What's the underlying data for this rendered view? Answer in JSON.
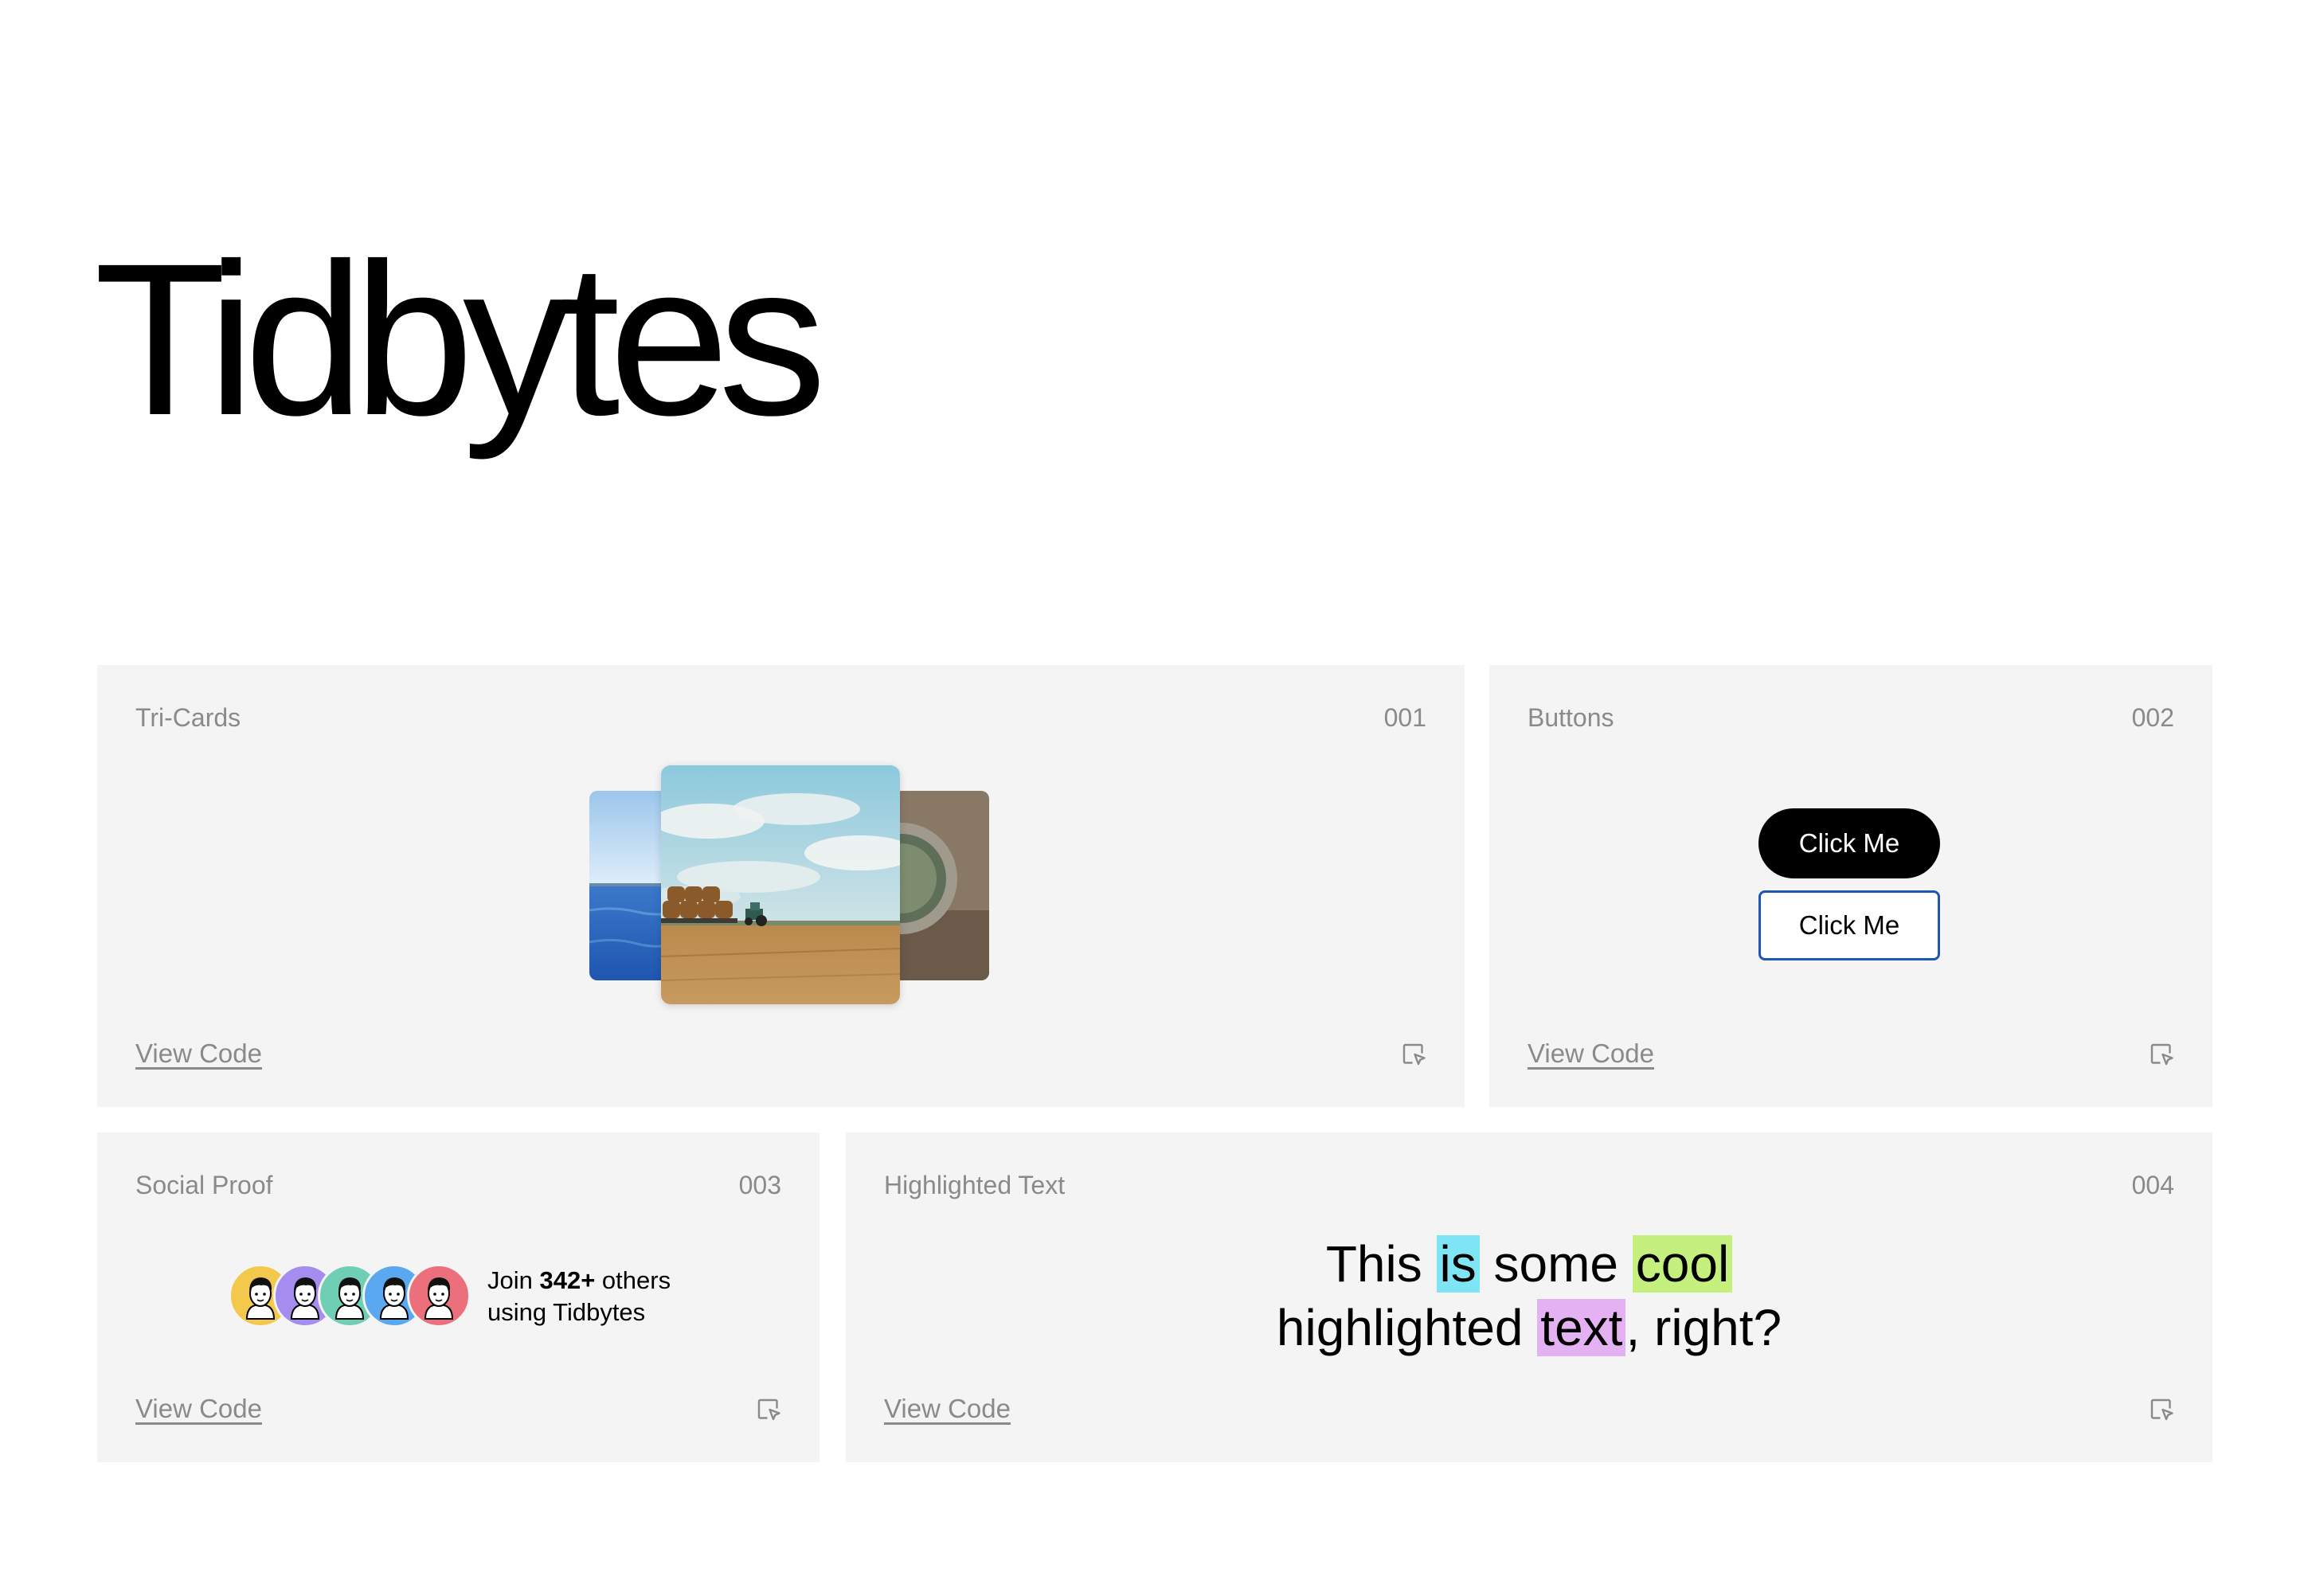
{
  "page": {
    "title": "Tidbytes"
  },
  "colors": {
    "card_bg": "#f4f4f4",
    "muted_text": "#8a8a8a",
    "button_outline": "#1f56b3",
    "highlight_cyan": "#7fe4f4",
    "highlight_green": "#c6f07e",
    "highlight_purple": "#e4b2f2"
  },
  "cards": [
    {
      "label": "Tri-Cards",
      "number": "001",
      "view_code": "View Code",
      "icon": "open-preview-icon"
    },
    {
      "label": "Buttons",
      "number": "002",
      "view_code": "View Code",
      "icon": "open-preview-icon",
      "buttons": {
        "primary": "Click Me",
        "secondary": "Click Me"
      }
    },
    {
      "label": "Social Proof",
      "number": "003",
      "view_code": "View Code",
      "icon": "open-preview-icon",
      "join_prefix": "Join ",
      "join_count": "342+",
      "join_suffix": " others",
      "join_line2": "using Tidbytes",
      "avatar_colors": [
        "#f2c94c",
        "#a58df0",
        "#6fcfb5",
        "#5aa9f0",
        "#ec6f7c"
      ]
    },
    {
      "label": "Highlighted Text",
      "number": "004",
      "view_code": "View Code",
      "icon": "open-preview-icon",
      "text": {
        "w1": "This ",
        "hl1": "is",
        "w2": " some ",
        "hl2": "cool",
        "w3": "highlighted ",
        "hl3": "text",
        "w4": ", right?"
      }
    }
  ]
}
